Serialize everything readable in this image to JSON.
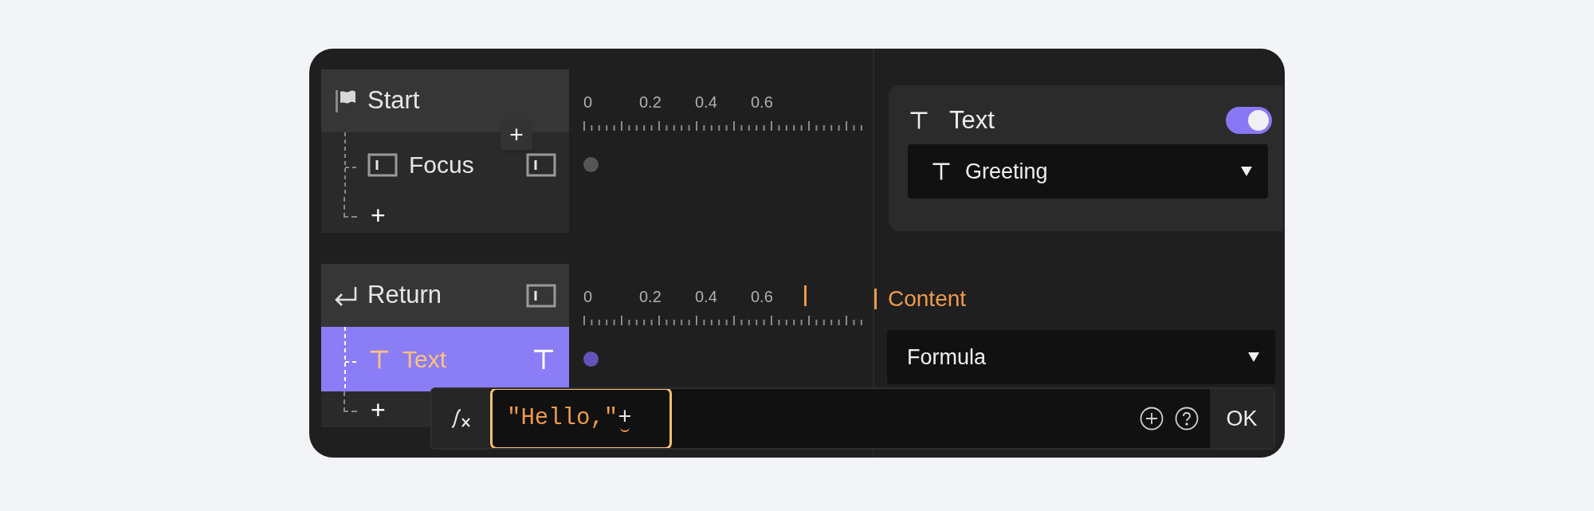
{
  "tracks": [
    {
      "kind": "start",
      "title": "Start",
      "trailing_icon": false,
      "ruler_labels": [
        "0",
        "0.2",
        "0.4",
        "0.6"
      ],
      "children": [
        {
          "kind": "frame",
          "label": "Focus",
          "selected": false
        }
      ]
    },
    {
      "kind": "return",
      "title": "Return",
      "trailing_icon": true,
      "ruler_labels": [
        "0",
        "0.2",
        "0.4",
        "0.6"
      ],
      "children": [
        {
          "kind": "text",
          "label": "Text",
          "selected": true
        }
      ]
    }
  ],
  "add_between_button": "+",
  "add_row_label": "+",
  "layer_card": {
    "title": "Text",
    "enabled": true,
    "dropdown": "Greeting"
  },
  "content": {
    "label": "Content",
    "dropdown": "Formula"
  },
  "formula_bar": {
    "string_part": "\"Hello,\"",
    "operator_part": "+",
    "ok": "OK"
  }
}
